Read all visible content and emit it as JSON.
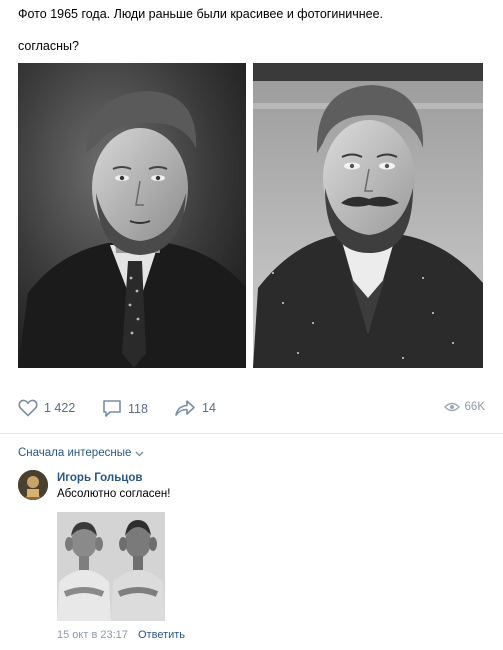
{
  "post": {
    "text_line1": "Фото 1965 года. Люди раньше были красивее и фотогиничнее.",
    "text_line2": "согласны?",
    "photos": [
      {
        "name": "portrait-left",
        "description": "black and white portrait of a bearded man in suit and tie"
      },
      {
        "name": "portrait-right",
        "description": "black and white portrait of a bearded man with mustache in coat"
      }
    ]
  },
  "actions": {
    "likes": "1 422",
    "comments": "118",
    "shares": "14",
    "views": "66K"
  },
  "comments_section": {
    "sort_label": "Сначала интересные",
    "comment": {
      "author": "Игорь Гольцов",
      "text": "Абсолютно согласен!",
      "timestamp": "15 окт в 23:17",
      "reply_label": "Ответить"
    }
  },
  "colors": {
    "link": "#2a5885",
    "icon": "#5a6e86",
    "muted": "#8c9aa9",
    "divider": "#e7e8ec"
  }
}
